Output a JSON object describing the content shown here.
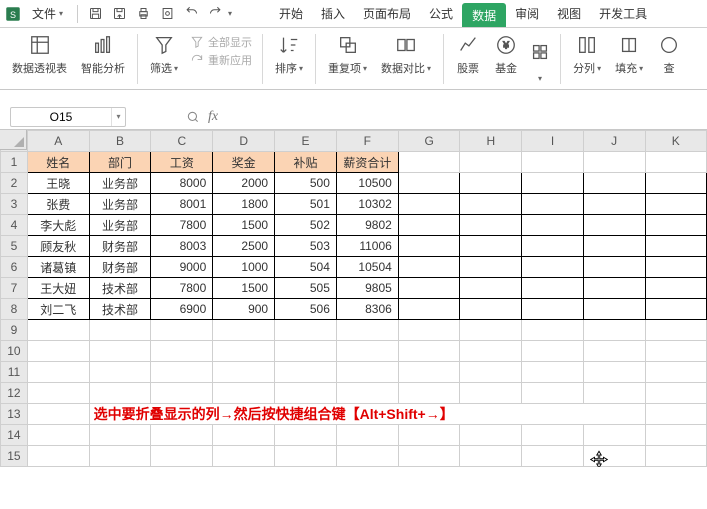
{
  "titlebar": {
    "file_label": "文件"
  },
  "menubar": {
    "items": [
      "开始",
      "插入",
      "页面布局",
      "公式",
      "数据",
      "审阅",
      "视图",
      "开发工具"
    ],
    "active_index": 4
  },
  "ribbon": {
    "pivot": "数据透视表",
    "smart": "智能分析",
    "filter": "筛选",
    "show_all": "全部显示",
    "reapply": "重新应用",
    "sort": "排序",
    "dup": "重复项",
    "compare": "数据对比",
    "stock": "股票",
    "fund": "基金",
    "split": "分列",
    "fill": "填充",
    "lookup": "查"
  },
  "formula_bar": {
    "namebox_value": "O15"
  },
  "sheet": {
    "columns": [
      "A",
      "B",
      "C",
      "D",
      "E",
      "F",
      "G",
      "H",
      "I",
      "J",
      "K"
    ],
    "headers": [
      "姓名",
      "部门",
      "工资",
      "奖金",
      "补贴",
      "薪资合计"
    ],
    "rows": [
      {
        "name": "王晓",
        "dept": "业务部",
        "salary": 8000,
        "bonus": 2000,
        "allow": 500,
        "total": 10500
      },
      {
        "name": "张费",
        "dept": "业务部",
        "salary": 8001,
        "bonus": 1800,
        "allow": 501,
        "total": 10302
      },
      {
        "name": "李大彪",
        "dept": "业务部",
        "salary": 7800,
        "bonus": 1500,
        "allow": 502,
        "total": 9802
      },
      {
        "name": "顾友秋",
        "dept": "财务部",
        "salary": 8003,
        "bonus": 2500,
        "allow": 503,
        "total": 11006
      },
      {
        "name": "诸葛镇",
        "dept": "财务部",
        "salary": 9000,
        "bonus": 1000,
        "allow": 504,
        "total": 10504
      },
      {
        "name": "王大妞",
        "dept": "技术部",
        "salary": 7800,
        "bonus": 1500,
        "allow": 505,
        "total": 9805
      },
      {
        "name": "刘二飞",
        "dept": "技术部",
        "salary": 6900,
        "bonus": 900,
        "allow": 506,
        "total": 8306
      }
    ],
    "tip": "选中要折叠显示的列→然后按快捷组合键【Alt+Shift+→】"
  }
}
